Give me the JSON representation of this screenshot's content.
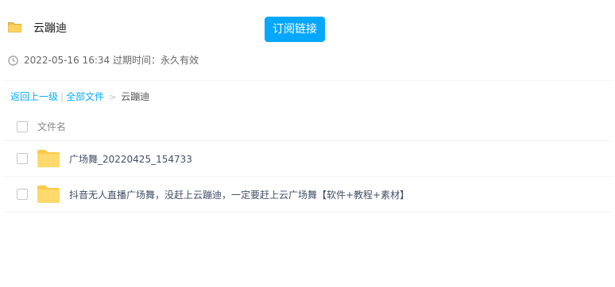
{
  "header": {
    "folder_icon": "folder-icon",
    "title": "云蹦迪",
    "subscribe_label": "订阅链接",
    "accent_color": "#06a7ff"
  },
  "meta": {
    "clock_icon": "clock-icon",
    "share_time": "2022-05-16 16:34",
    "expire_label": "过期时间：永久有效"
  },
  "breadcrumb": {
    "back_label": "返回上一级",
    "separator": "|",
    "all_files_label": "全部文件",
    "arrow": ">",
    "current": "云蹦迪",
    "link_color": "#09aaff"
  },
  "file_list": {
    "column_header": "文件名",
    "rows": [
      {
        "icon": "folder-icon",
        "name": "广场舞_20220425_154733"
      },
      {
        "icon": "folder-icon",
        "name": "抖音无人直播广场舞，没赶上云蹦迪，一定要赶上云广场舞【软件+教程+素材】"
      }
    ]
  }
}
